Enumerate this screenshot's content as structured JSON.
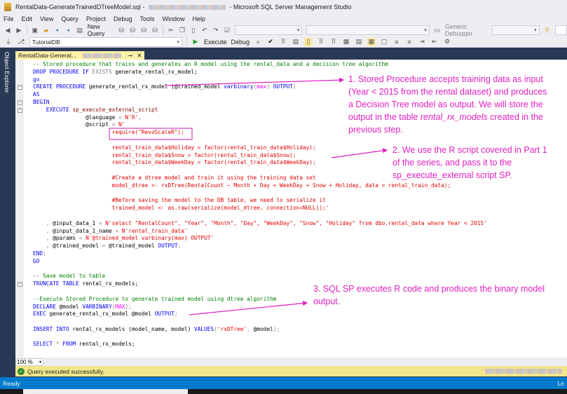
{
  "window": {
    "title_prefix": "RentalData-GenerateTrainedDTreeModel.sql - ",
    "title_suffix": " - Microsoft SQL Server Management Studio"
  },
  "menu": [
    "File",
    "Edit",
    "View",
    "Query",
    "Project",
    "Debug",
    "Tools",
    "Window",
    "Help"
  ],
  "toolbar1": {
    "new_query": "New Query",
    "debugger": "Generic Debugger"
  },
  "toolbar2": {
    "database": "TutorialDB",
    "execute": "Execute",
    "debug": "Debug"
  },
  "sidebar": {
    "label": "Object Explorer"
  },
  "tab": {
    "label": "RentalData-Generat...",
    "pin": "⊸",
    "close": "✕"
  },
  "code": [
    [
      [
        "c",
        "-- Stored procedure that trains and generates an R model using the rental_data and a decision tree algorithm"
      ]
    ],
    [
      [
        "k",
        "DROP PROCEDURE IF "
      ],
      [
        "g",
        "EXISTS"
      ],
      [
        "t",
        " generate_rental_rx_model;"
      ]
    ],
    [
      [
        "k",
        "go"
      ]
    ],
    [
      [
        "k",
        "CREATE PROCEDURE"
      ],
      [
        "t",
        " generate_rental_rx_model (@trained_model "
      ],
      [
        "k",
        "varbinary"
      ],
      [
        "g",
        "("
      ],
      [
        "f",
        "max"
      ],
      [
        "g",
        ")"
      ],
      [
        "k",
        " OUTPUT"
      ],
      [
        "g",
        ")"
      ]
    ],
    [
      [
        "k",
        "AS"
      ]
    ],
    [
      [
        "k",
        "BEGIN"
      ]
    ],
    [
      [
        "t",
        "    "
      ],
      [
        "k",
        "EXECUTE"
      ],
      [
        "sys",
        " sp_execute_external_script"
      ]
    ],
    [
      [
        "t",
        "                @language "
      ],
      [
        "g",
        "="
      ],
      [
        "s",
        " N'R'"
      ],
      [
        "g",
        ","
      ]
    ],
    [
      [
        "t",
        "                @script "
      ],
      [
        "g",
        "="
      ],
      [
        "s",
        " N'"
      ]
    ],
    [
      [
        "s",
        "                        require(\"RevoScaleR\");"
      ]
    ],
    [],
    [
      [
        "s",
        "                        rental_train_data$Holiday = factor(rental_train_data$Holiday);"
      ]
    ],
    [
      [
        "s",
        "                        rental_train_data$Snow = factor(rental_train_data$Snow);"
      ]
    ],
    [
      [
        "s",
        "                        rental_train_data$WeekDay = factor(rental_train_data$WeekDay);"
      ]
    ],
    [],
    [
      [
        "s",
        "                        #Create a dtree model and train it using the training data set"
      ]
    ],
    [
      [
        "s",
        "                        model_dtree <- rxDTree(RentalCount ~ Month + Day + WeekDay + Snow + Holiday, data = rental_train_data);"
      ]
    ],
    [],
    [
      [
        "s",
        "                        #Before saving the model to the DB table, we need to serialize it"
      ]
    ],
    [
      [
        "s",
        "                        trained_model <- as.raw(serialize(model_dtree, connection=NULL));'"
      ]
    ],
    [],
    [
      [
        "g",
        "    , "
      ],
      [
        "t",
        "@input_data_1 "
      ],
      [
        "g",
        "="
      ],
      [
        "s",
        " N'select \"RentalCount\", \"Year\", \"Month\", \"Day\", \"WeekDay\", \"Snow\", \"Holiday\" from dbo.rental_data where Year < 2015'"
      ]
    ],
    [
      [
        "g",
        "    , "
      ],
      [
        "t",
        "@input_data_1_name "
      ],
      [
        "g",
        "="
      ],
      [
        "s",
        " N'rental_train_data'"
      ]
    ],
    [
      [
        "g",
        "    , "
      ],
      [
        "t",
        "@params "
      ],
      [
        "g",
        "="
      ],
      [
        "s",
        " N'@trained_model varbinary(max) OUTPUT'"
      ]
    ],
    [
      [
        "g",
        "    , "
      ],
      [
        "t",
        "@trained_model "
      ],
      [
        "g",
        "="
      ],
      [
        "t",
        " @trained_model "
      ],
      [
        "k",
        "OUTPUT"
      ],
      [
        "g",
        ";"
      ]
    ],
    [
      [
        "k",
        "END"
      ],
      [
        "g",
        ";"
      ]
    ],
    [
      [
        "k",
        "GO"
      ]
    ],
    [],
    [
      [
        "c",
        "-- Save model to table"
      ]
    ],
    [
      [
        "k",
        "TRUNCATE TABLE"
      ],
      [
        "t",
        " rental_rx_models;"
      ]
    ],
    [],
    [
      [
        "c",
        "--Execute Stored Procedure to generate trained model using dtree algorithm"
      ]
    ],
    [
      [
        "k",
        "DECLARE"
      ],
      [
        "t",
        " @model "
      ],
      [
        "k",
        "VARBINARY"
      ],
      [
        "g",
        "("
      ],
      [
        "f",
        "MAX"
      ],
      [
        "g",
        ");"
      ]
    ],
    [
      [
        "k",
        "EXEC"
      ],
      [
        "t",
        " generate_rental_rx_model @model "
      ],
      [
        "k",
        "OUTPUT"
      ],
      [
        "g",
        ";"
      ]
    ],
    [],
    [
      [
        "k",
        "INSERT INTO"
      ],
      [
        "t",
        " rental_rx_models (model_name, model) "
      ],
      [
        "k",
        "VALUES"
      ],
      [
        "g",
        "("
      ],
      [
        "s",
        "'rxDTree'"
      ],
      [
        "g",
        ","
      ],
      [
        "t",
        " @model"
      ],
      [
        "g",
        ");"
      ]
    ],
    [],
    [
      [
        "k",
        "SELECT"
      ],
      [
        "g",
        " * "
      ],
      [
        "k",
        "FROM"
      ],
      [
        "t",
        " rental_rx_models;"
      ]
    ]
  ],
  "annotations": [
    {
      "lines": [
        "1. Stored Procedure accepts training data as input",
        "(Year < 2015 from the rental dataset) and produces",
        "a Decision Tree model as output. We will store the"
      ],
      "last_pre": "output in the table ",
      "last_em": "rental_rx_models",
      "last_post": " created in the",
      "extra": "previous step."
    },
    {
      "lines": [
        "2. We use the R script covered in Part 1",
        "of the series, and pass it to the",
        "sp_execute_external script SP."
      ]
    },
    {
      "lines": [
        "3. SQL SP executes R code and produces the binary model",
        "output."
      ]
    }
  ],
  "zoom": {
    "level": "100 %"
  },
  "query_status": {
    "message": "Query executed successfully."
  },
  "statusbar": {
    "left": "Ready",
    "right": "Ln"
  },
  "colors": {
    "accent": "#007acc",
    "annotation": "#e020c0",
    "status_yellow": "#f0e68c"
  }
}
